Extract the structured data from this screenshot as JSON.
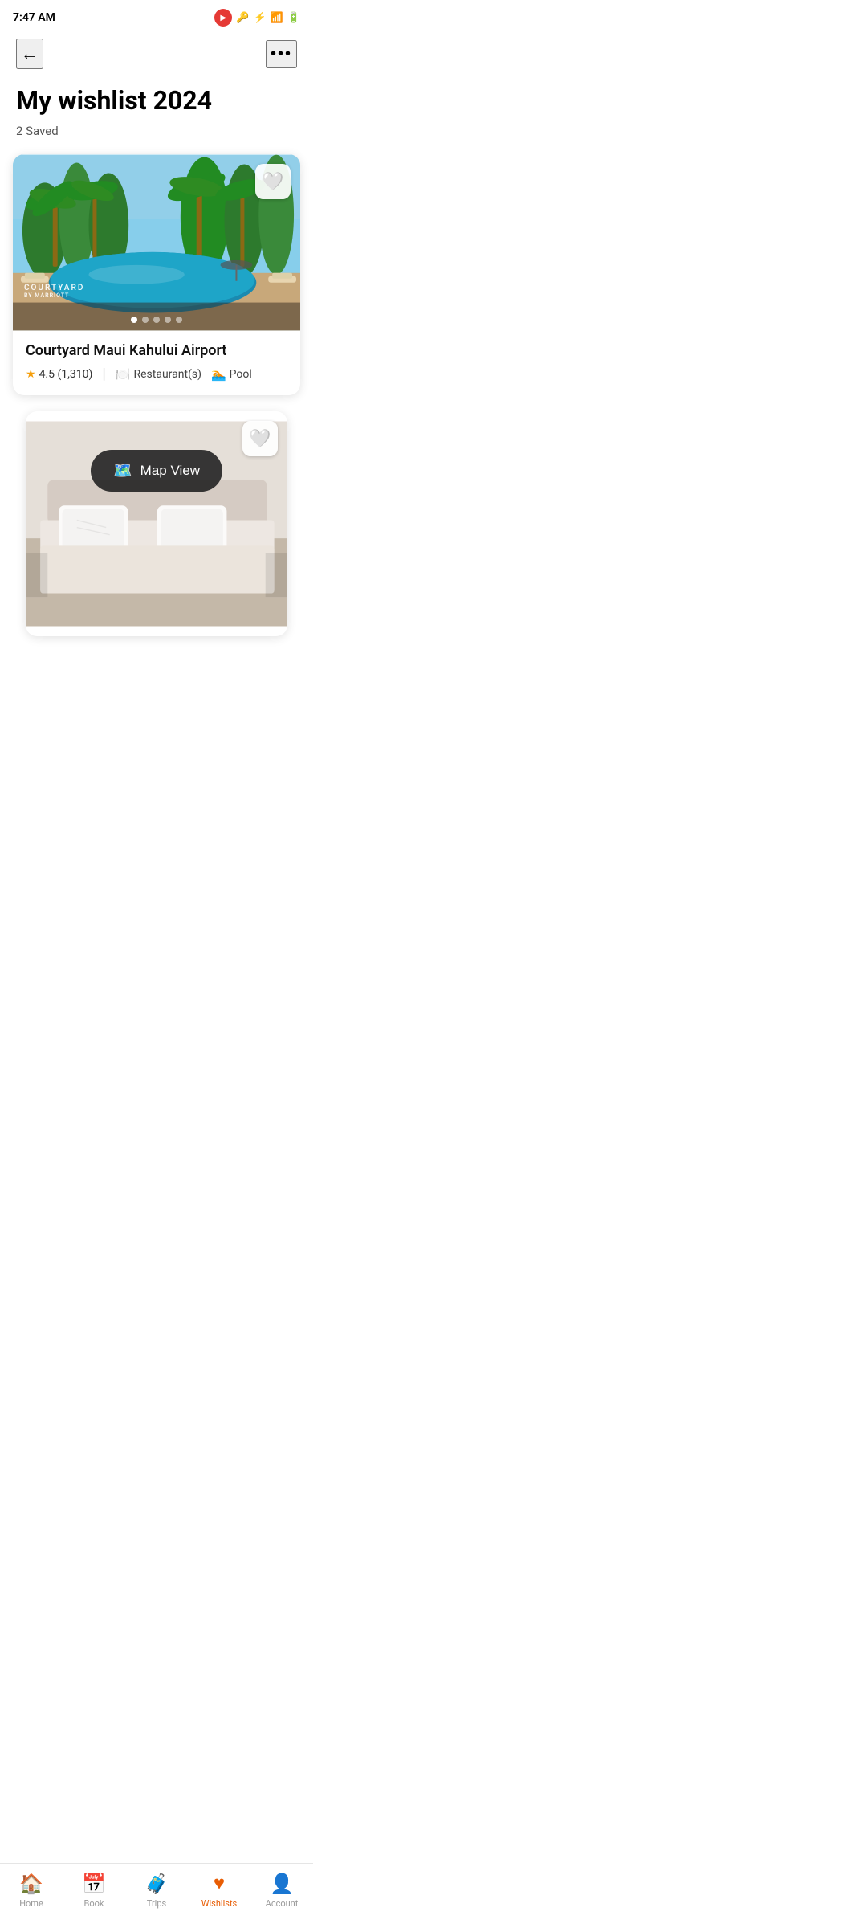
{
  "statusBar": {
    "time": "7:47 AM",
    "ampm": "AM"
  },
  "topNav": {
    "backLabel": "←",
    "moreLabel": "•••"
  },
  "pageHeader": {
    "title": "My wishlist 2024",
    "savedCount": "2 Saved"
  },
  "cards": [
    {
      "id": "card-1",
      "hotelName": "Courtyard Maui Kahului Airport",
      "rating": "4.5",
      "reviewCount": "(1,310)",
      "amenities": [
        "Restaurant(s)",
        "Pool"
      ],
      "logoLine1": "COURTYARD",
      "logoLine2": "BY MARRIOTT",
      "dots": 5,
      "activeDot": 0
    },
    {
      "id": "card-2",
      "hotelName": "",
      "amenities": []
    }
  ],
  "mapViewBtn": {
    "label": "Map View"
  },
  "bottomNav": {
    "items": [
      {
        "id": "home",
        "label": "Home",
        "icon": "🏠",
        "active": false
      },
      {
        "id": "book",
        "label": "Book",
        "icon": "📅",
        "active": false
      },
      {
        "id": "trips",
        "label": "Trips",
        "icon": "🧳",
        "active": false
      },
      {
        "id": "wishlists",
        "label": "Wishlists",
        "icon": "♥",
        "active": true
      },
      {
        "id": "account",
        "label": "Account",
        "icon": "👤",
        "active": false
      }
    ]
  }
}
